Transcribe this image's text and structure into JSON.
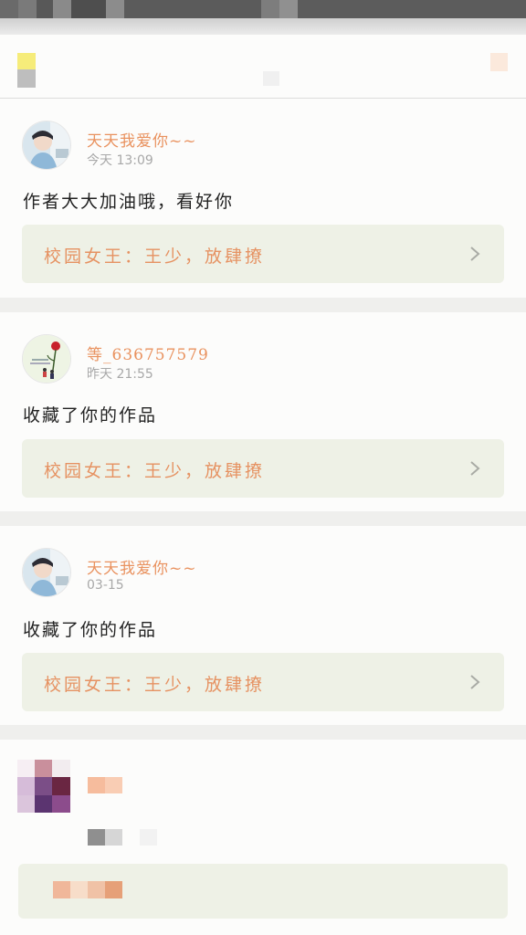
{
  "comments": [
    {
      "username": "天天我爱你~~",
      "time": "今天 13:09",
      "content": "作者大大加油哦，看好你",
      "work": "校园女王：王少，放肆撩"
    },
    {
      "username": "等_636757579",
      "time": "昨天 21:55",
      "content": "收藏了你的作品",
      "work": "校园女王：王少，放肆撩"
    },
    {
      "username": "天天我爱你~~",
      "time": "03-15",
      "content": "收藏了你的作品",
      "work": "校园女王：王少，放肆撩"
    }
  ],
  "icons": {
    "chevron": "chevron-right-icon",
    "avatar_1": "user-avatar",
    "avatar_2": "rose-avatar"
  },
  "colors": {
    "username": "#e9925f",
    "work_title": "#e69262",
    "work_bg": "#eef1e6",
    "time": "#a8a8a8"
  }
}
